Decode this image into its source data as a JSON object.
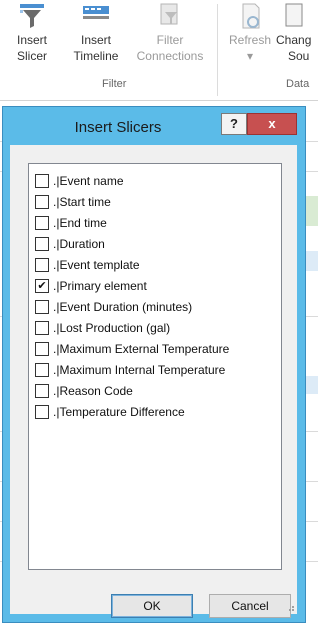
{
  "ribbon": {
    "buttons": {
      "insert_slicer": [
        "Insert",
        "Slicer"
      ],
      "insert_timeline": [
        "Insert",
        "Timeline"
      ],
      "filter_connections": [
        "Filter",
        "Connections"
      ],
      "refresh": [
        "Refresh",
        "▾"
      ],
      "change": [
        "Chang",
        "Sou"
      ]
    },
    "groups": {
      "filter": "Filter",
      "data": "Data"
    }
  },
  "dialog": {
    "title": "Insert Slicers",
    "help_label": "?",
    "close_label": "x",
    "fields": [
      {
        "label": ".|Event name",
        "checked": false
      },
      {
        "label": ".|Start time",
        "checked": false
      },
      {
        "label": ".|End time",
        "checked": false
      },
      {
        "label": ".|Duration",
        "checked": false
      },
      {
        "label": ".|Event template",
        "checked": false
      },
      {
        "label": ".|Primary element",
        "checked": true
      },
      {
        "label": ".|Event Duration (minutes)",
        "checked": false
      },
      {
        "label": ".|Lost Production (gal)",
        "checked": false
      },
      {
        "label": ".|Maximum External Temperature",
        "checked": false
      },
      {
        "label": ".|Maximum Internal Temperature",
        "checked": false
      },
      {
        "label": ".|Reason Code",
        "checked": false
      },
      {
        "label": ".|Temperature Difference",
        "checked": false
      }
    ],
    "ok_label": "OK",
    "cancel_label": "Cancel"
  }
}
